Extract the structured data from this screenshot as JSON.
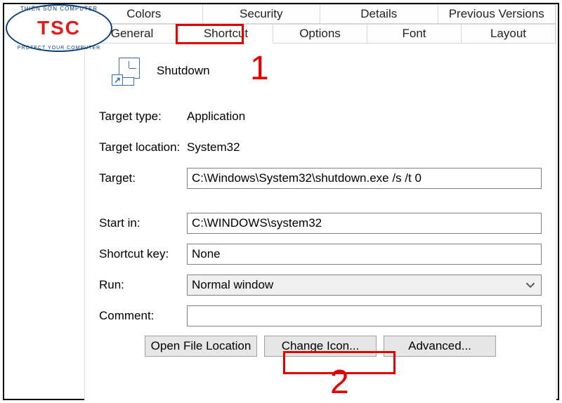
{
  "logo": {
    "top_text": "THIÊN SƠN COMPUTER",
    "main": "TSC",
    "bottom_text": "PROTECT YOUR COMPUTER"
  },
  "tabs_row1": [
    "Colors",
    "Security",
    "Details",
    "Previous Versions"
  ],
  "tabs_row2": [
    "General",
    "Shortcut",
    "Options",
    "Font",
    "Layout"
  ],
  "active_tab": "Shortcut",
  "shortcut_name": "Shutdown",
  "fields": {
    "target_type_label": "Target type:",
    "target_type_value": "Application",
    "target_location_label": "Target location:",
    "target_location_value": "System32",
    "target_label": "Target:",
    "target_value": "C:\\Windows\\System32\\shutdown.exe /s /t 0",
    "start_in_label": "Start in:",
    "start_in_value": "C:\\WINDOWS\\system32",
    "shortcut_key_label": "Shortcut key:",
    "shortcut_key_value": "None",
    "run_label": "Run:",
    "run_value": "Normal window",
    "comment_label": "Comment:",
    "comment_value": ""
  },
  "buttons": {
    "open_file_location": "Open File Location",
    "change_icon": "Change Icon...",
    "advanced": "Advanced..."
  },
  "annotations": {
    "marker1": "1",
    "marker2": "2"
  }
}
